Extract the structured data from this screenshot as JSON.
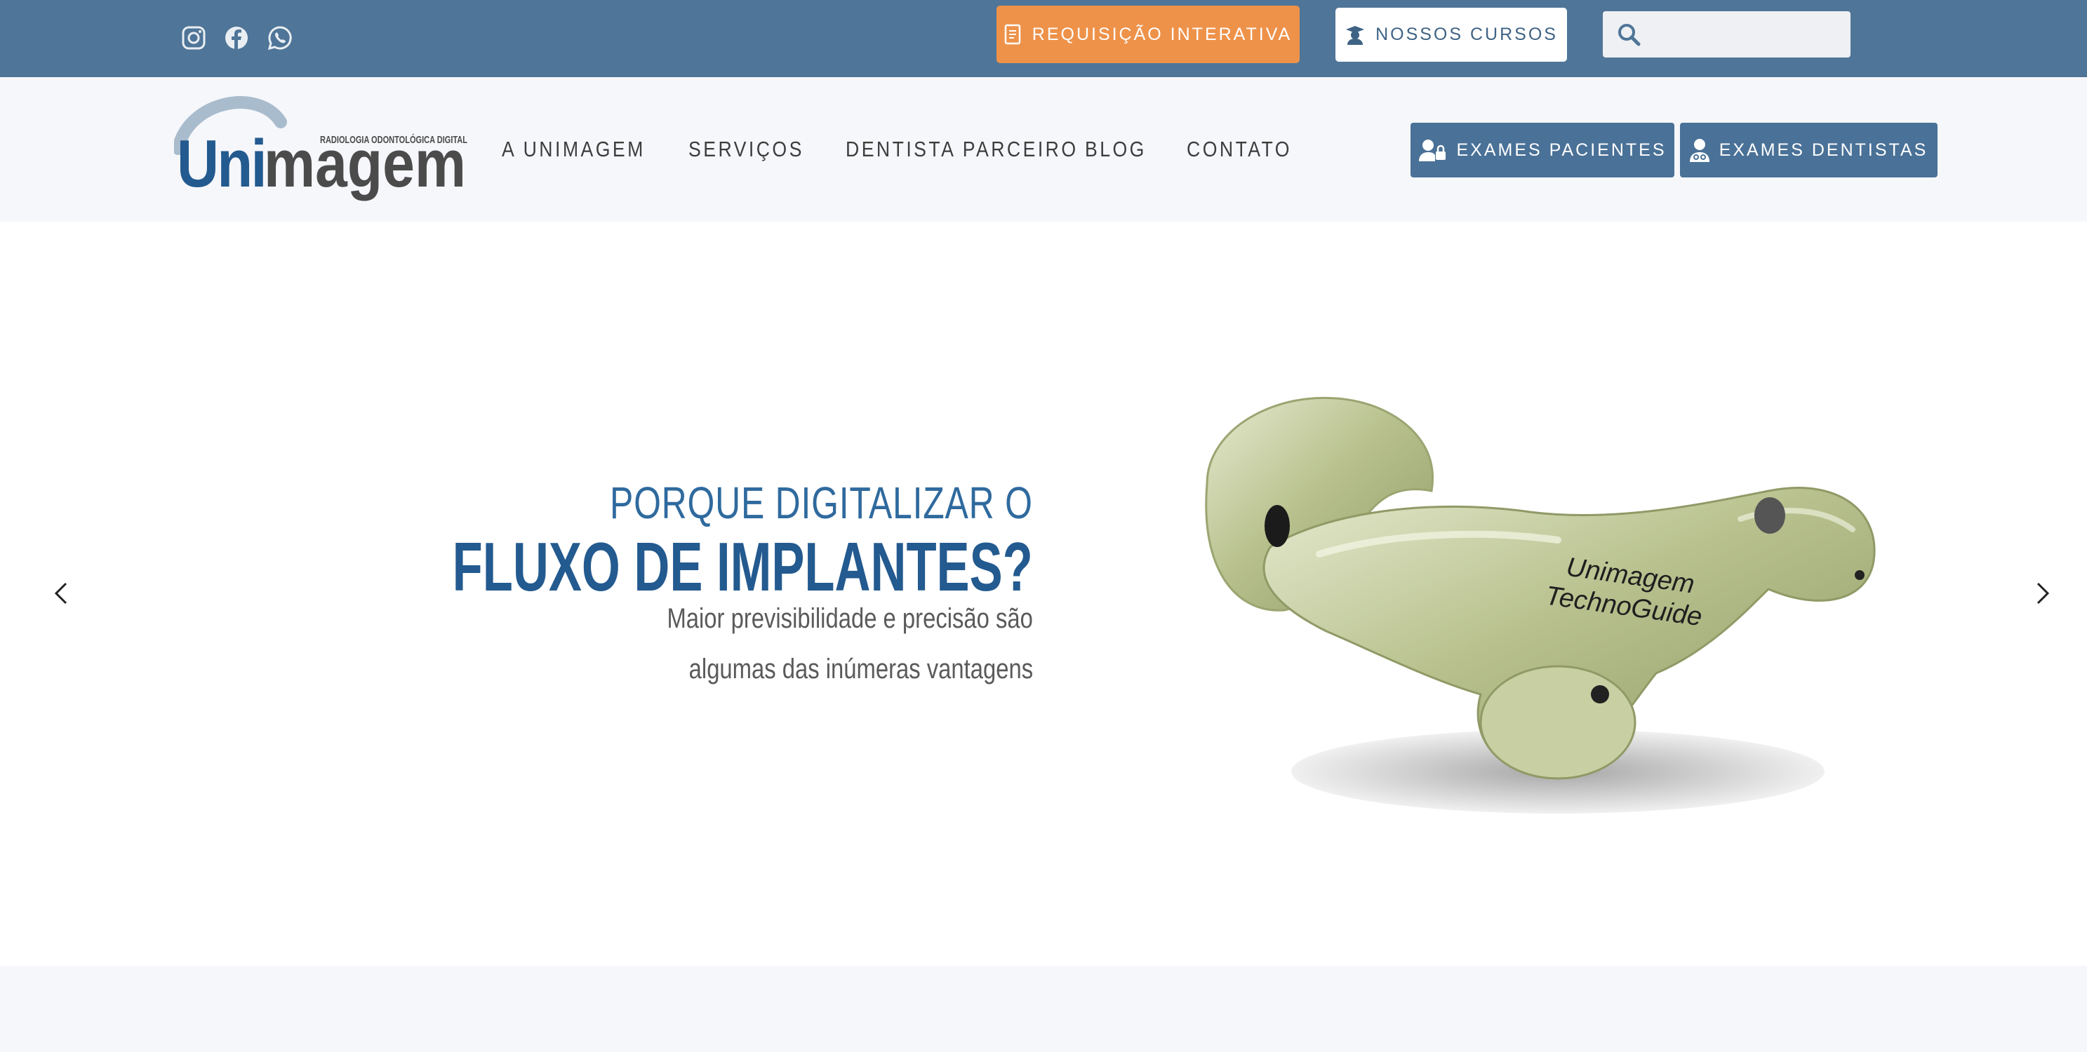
{
  "topbar": {
    "social_icons": [
      "instagram-icon",
      "facebook-icon",
      "whatsapp-icon"
    ],
    "requisicao_label": "REQUISIÇÃO INTERATIVA",
    "cursos_label": "NOSSOS CURSOS",
    "search_placeholder": "",
    "colors": {
      "bar": "#4f7598",
      "requisicao": "#ee924a"
    }
  },
  "logo": {
    "brand_uni": "Uni",
    "brand_magem": "magem",
    "tagline": "RADIOLOGIA ODONTOLÓGICA DIGITAL"
  },
  "nav": {
    "items": [
      "A UNIMAGEM",
      "SERVIÇOS",
      "DENTISTA PARCEIRO",
      "BLOG",
      "CONTATO"
    ],
    "exames_pacientes": "EXAMES PACIENTES",
    "exames_dentistas": "EXAMES DENTISTAS"
  },
  "hero": {
    "title_small": "PORQUE DIGITALIZAR O",
    "title_big": "FLUXO DE IMPLANTES?",
    "subtitle_line1": "Maior previsibilidade e precisão são",
    "subtitle_line2": "algumas das inúmeras vantagens",
    "guide_engraving_1": "Unimagem",
    "guide_engraving_2": "TechnoGuide"
  }
}
